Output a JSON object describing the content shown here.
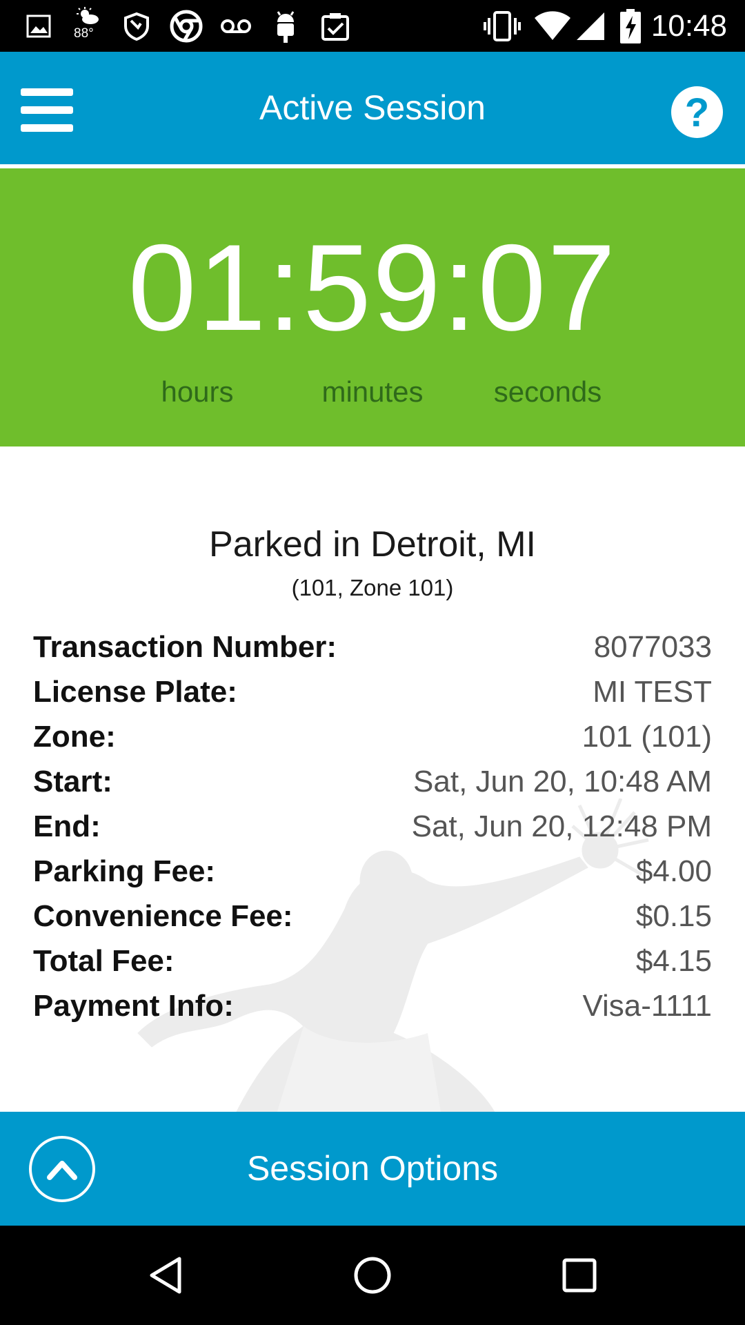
{
  "status_bar": {
    "time": "10:48",
    "weather_temp": "88°",
    "icons": [
      "gallery-icon",
      "weather-icon",
      "shield-icon",
      "chrome-icon",
      "voicemail-icon",
      "android-icon",
      "clipboard-check-icon",
      "vibrate-icon",
      "wifi-icon",
      "cell-signal-icon",
      "battery-charging-icon"
    ]
  },
  "app_bar": {
    "title": "Active Session",
    "menu_icon": "menu-icon",
    "help_label": "?"
  },
  "timer": {
    "value": "01:59:07",
    "units": [
      "hours",
      "minutes",
      "seconds"
    ]
  },
  "location": {
    "title": "Parked in Detroit, MI",
    "subtitle": "(101, Zone 101)"
  },
  "details": [
    {
      "label": "Transaction Number:",
      "value": "8077033"
    },
    {
      "label": "License Plate:",
      "value": "MI TEST"
    },
    {
      "label": "Zone:",
      "value": "101 (101)"
    },
    {
      "label": "Start:",
      "value": "Sat, Jun 20, 10:48 AM"
    },
    {
      "label": "End:",
      "value": "Sat, Jun 20, 12:48 PM"
    },
    {
      "label": "Parking Fee:",
      "value": "$4.00"
    },
    {
      "label": "Convenience Fee:",
      "value": "$0.15"
    },
    {
      "label": "Total Fee:",
      "value": "$4.15"
    },
    {
      "label": "Payment Info:",
      "value": "Visa-1111"
    }
  ],
  "session_options": {
    "label": "Session Options",
    "icon": "chevron-up-icon"
  },
  "nav_bar": {
    "icons": [
      "back-icon",
      "home-icon",
      "recents-icon"
    ]
  },
  "colors": {
    "app_blue": "#0099cc",
    "timer_green": "#6fbe2c",
    "unit_text": "#2f6a1a"
  }
}
